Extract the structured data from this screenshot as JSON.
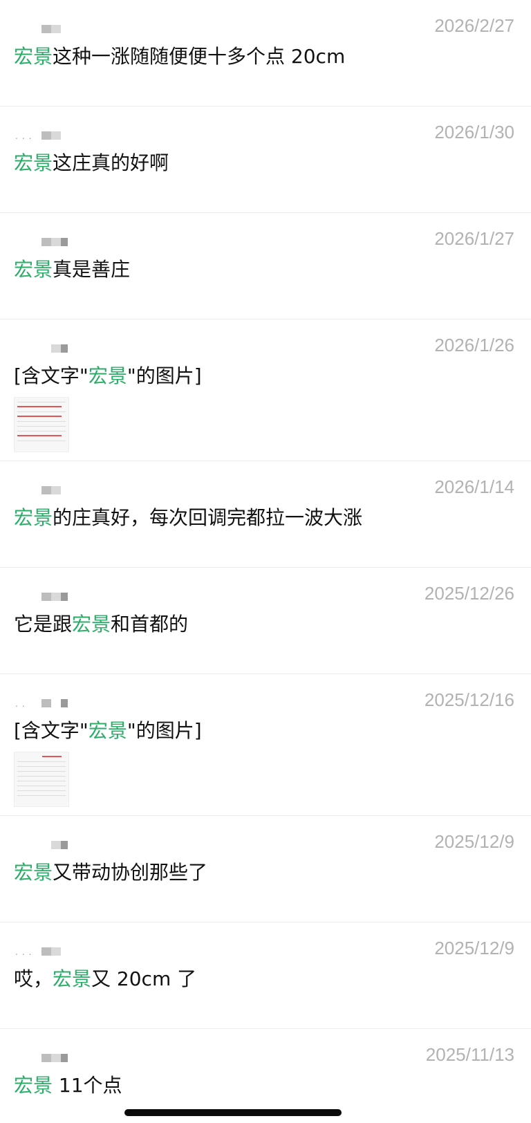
{
  "messages": [
    {
      "date": "2026/2/27",
      "pre": "",
      "keyword": "宏景",
      "post": "这种一涨随随便便十多个点 20cm",
      "has_image": false
    },
    {
      "date": "2026/1/30",
      "pre": "",
      "keyword": "宏景",
      "post": "这庄真的好啊",
      "has_image": false
    },
    {
      "date": "2026/1/27",
      "pre": "",
      "keyword": "宏景",
      "post": "真是善庄",
      "has_image": false
    },
    {
      "date": "2026/1/26",
      "pre": "[含文字\"",
      "keyword": "宏景",
      "post": "\"的图片]",
      "has_image": true
    },
    {
      "date": "2026/1/14",
      "pre": "",
      "keyword": "宏景",
      "post": "的庄真好，每次回调完都拉一波大涨",
      "has_image": false
    },
    {
      "date": "2025/12/26",
      "pre": "它是跟",
      "keyword": "宏景",
      "post": "和首都的",
      "has_image": false
    },
    {
      "date": "2025/12/16",
      "pre": "[含文字\"",
      "keyword": "宏景",
      "post": "\"的图片]",
      "has_image": true
    },
    {
      "date": "2025/12/9",
      "pre": "",
      "keyword": "宏景",
      "post": "又带动协创那些了",
      "has_image": false
    },
    {
      "date": "2025/12/9",
      "pre": "哎，",
      "keyword": "宏景",
      "post": "又 20cm 了",
      "has_image": false
    },
    {
      "date": "2025/11/13",
      "pre": "",
      "keyword": "宏景",
      "post": " 11个点",
      "has_image": false
    }
  ],
  "colors": {
    "keyword_highlight": "#2aae67",
    "date_text": "#b2b2b2",
    "message_text": "#111111"
  }
}
